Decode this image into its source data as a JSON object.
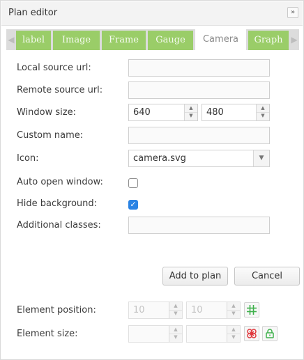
{
  "title": "Plan editor",
  "collapse_label": "»",
  "tabs": [
    {
      "label": "label",
      "active": false
    },
    {
      "label": "Image",
      "active": false
    },
    {
      "label": "Frame",
      "active": false
    },
    {
      "label": "Gauge",
      "active": false
    },
    {
      "label": "Camera",
      "active": true
    },
    {
      "label": "Graph",
      "active": false
    }
  ],
  "form": {
    "local_source_url": {
      "label": "Local source url:",
      "value": ""
    },
    "remote_source_url": {
      "label": "Remote source url:",
      "value": ""
    },
    "window_size": {
      "label": "Window size:",
      "width": "640",
      "height": "480"
    },
    "custom_name": {
      "label": "Custom name:",
      "value": ""
    },
    "icon": {
      "label": "Icon:",
      "value": "camera.svg"
    },
    "auto_open_window": {
      "label": "Auto open window:",
      "checked": false
    },
    "hide_background": {
      "label": "Hide background:",
      "checked": true
    },
    "additional_classes": {
      "label": "Additional classes:",
      "value": ""
    }
  },
  "buttons": {
    "add": "Add to plan",
    "cancel": "Cancel"
  },
  "element_position": {
    "label": "Element position:",
    "x": "10",
    "y": "10"
  },
  "element_size": {
    "label": "Element size:",
    "width": "",
    "height": ""
  },
  "colors": {
    "tab_green": "#9acd68",
    "checkbox_blue": "#2a83e4",
    "icon_green": "#3fb14c",
    "icon_red": "#e0393e"
  }
}
